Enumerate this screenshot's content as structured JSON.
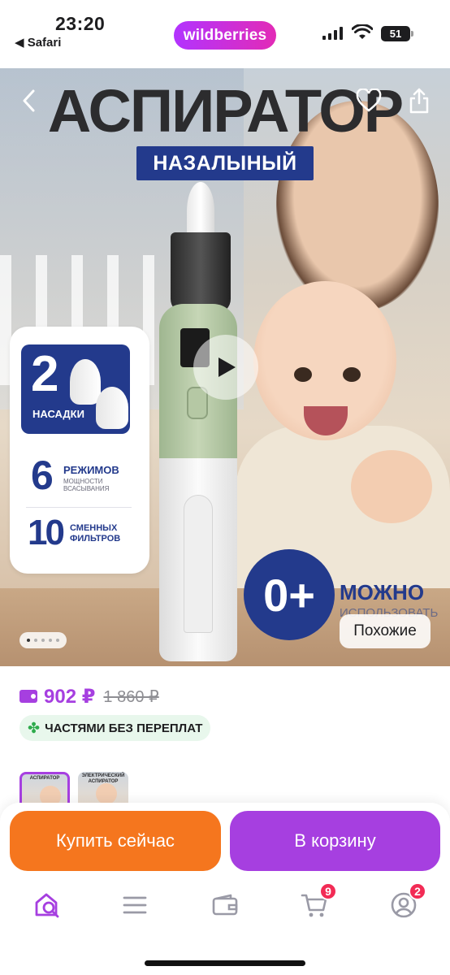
{
  "status_bar": {
    "time": "23:20",
    "back_app": "◀ Safari",
    "brand": "wildberries",
    "battery": "51"
  },
  "hero": {
    "title": "АСПИРАТОР",
    "subtitle": "НАЗАЛЫНЫЙ",
    "card": {
      "nozzles_count": "2",
      "nozzles_label": "НАСАДКИ",
      "modes_count": "6",
      "modes_label": "РЕЖИМОВ",
      "modes_sub": "МОЩНОСТИ ВСАСЫВАНИЯ",
      "filters_count": "10",
      "filters_label": "СМЕННЫХ ФИЛЬТРОВ"
    },
    "age_badge": "0+",
    "age_main": "МОЖНО",
    "age_sub": "ИСПОЛЬЗОВАТЬ",
    "similar_button": "Похожие",
    "gallery_pages": 5,
    "gallery_current": 1
  },
  "product": {
    "price": "902 ₽",
    "old_price": "1 860 ₽",
    "installment": "ЧАСТЯМИ БЕЗ ПЕРЕПЛАТ",
    "thumb1_caption": "АСПИРАТОР",
    "thumb2_caption": "ЭЛЕКТРИЧЕСКИЙ АСПИРАТОР"
  },
  "actions": {
    "buy_now": "Купить сейчас",
    "add_to_cart": "В корзину"
  },
  "tabbar": {
    "cart_badge": "9",
    "profile_badge": "2"
  },
  "colors": {
    "brand_purple": "#a63fe0",
    "buy_orange": "#f5761e",
    "navy": "#233a8c",
    "badge_red": "#f22b55"
  }
}
